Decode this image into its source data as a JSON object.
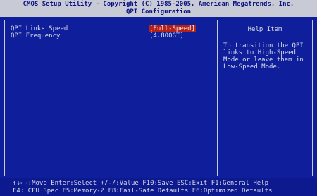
{
  "title": {
    "line1": "CMOS Setup Utility - Copyright (C) 1985-2005, American Megatrends, Inc.",
    "line2": "QPI Configuration"
  },
  "settings": [
    {
      "label": "QPI Links Speed",
      "value": "[Full-Speed]"
    },
    {
      "label": "QPI Frequency",
      "value": "[4.800GT]"
    }
  ],
  "help": {
    "title": "Help Item",
    "text": "To transition the QPI\nlinks to High-Speed\nMode or leave them in\nLow-Speed Mode."
  },
  "footer": {
    "line1": "↑↓←→:Move   Enter:Select   +/-/:Value   F10:Save   ESC:Exit   F1:General Help",
    "line2": "F4: CPU Spec   F5:Memory-Z   F8:Fail-Safe Defaults   F6:Optimized Defaults"
  }
}
